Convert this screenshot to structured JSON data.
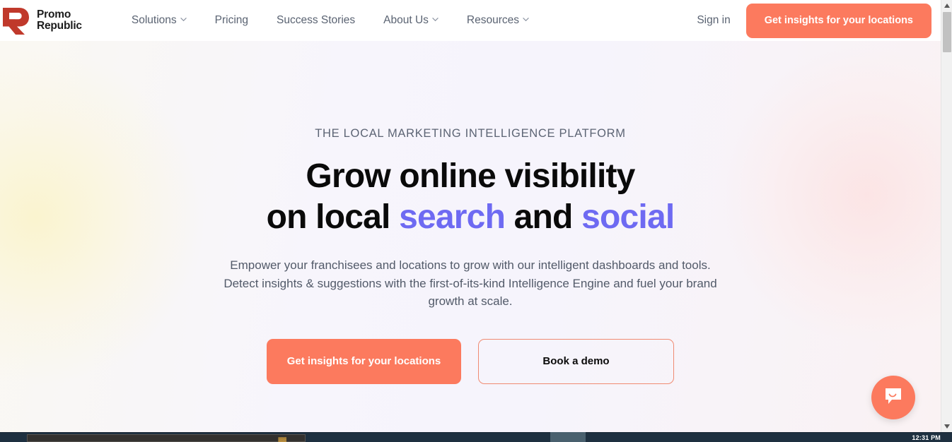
{
  "brand": {
    "logo_icon": "promorepublic-logo-icon",
    "name_line1": "Promo",
    "name_line2": "Republic",
    "accent_coral": "#FC7A5E",
    "accent_purple": "#6E6AF2",
    "logo_red": "#C0392B"
  },
  "header": {
    "nav": [
      {
        "label": "Solutions",
        "has_dropdown": true
      },
      {
        "label": "Pricing",
        "has_dropdown": false
      },
      {
        "label": "Success Stories",
        "has_dropdown": false
      },
      {
        "label": "About Us",
        "has_dropdown": true
      },
      {
        "label": "Resources",
        "has_dropdown": true
      }
    ],
    "signin_label": "Sign in",
    "cta_label": "Get insights for your locations"
  },
  "hero": {
    "eyebrow": "THE LOCAL MARKETING INTELLIGENCE PLATFORM",
    "headline_line1": "Grow online visibility",
    "headline_line2_part1": "on local ",
    "headline_line2_accent1": "search",
    "headline_line2_part2": " and ",
    "headline_line2_accent2": "social",
    "subtitle": "Empower your franchisees and locations to grow with our intelligent dashboards and tools. Detect insights & suggestions with the first-of-its-kind Intelligence Engine and fuel your brand growth at scale.",
    "primary_cta": "Get insights for your locations",
    "secondary_cta": "Book a demo"
  },
  "chat": {
    "icon": "chat-bubble-smile-icon",
    "aria_label": "Open Intercom Messenger"
  },
  "scrollbar": {
    "up_arrow": "scroll-up-arrow",
    "down_arrow": "scroll-down-arrow",
    "thumb": "scroll-thumb"
  },
  "os": {
    "clock": "12:31 PM",
    "window_glyph": "▓▓"
  }
}
